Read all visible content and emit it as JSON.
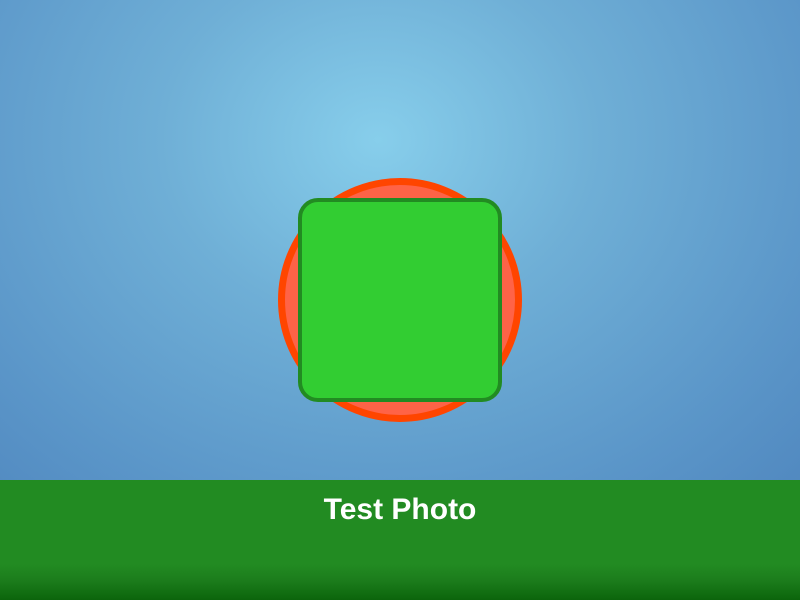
{
  "caption": {
    "text": "Test Photo"
  },
  "colors": {
    "sky_center": "#87CEEB",
    "sky_edge": "#4F86BE",
    "ground": "#228B22",
    "circle_fill": "#FF6347",
    "circle_stroke": "#FF4500",
    "square_fill": "#32CD32",
    "square_stroke": "#228B22",
    "caption_text": "#FFFFFF"
  },
  "shapes": [
    {
      "kind": "circle",
      "name": "red-circle"
    },
    {
      "kind": "rounded-square",
      "name": "green-square"
    }
  ]
}
